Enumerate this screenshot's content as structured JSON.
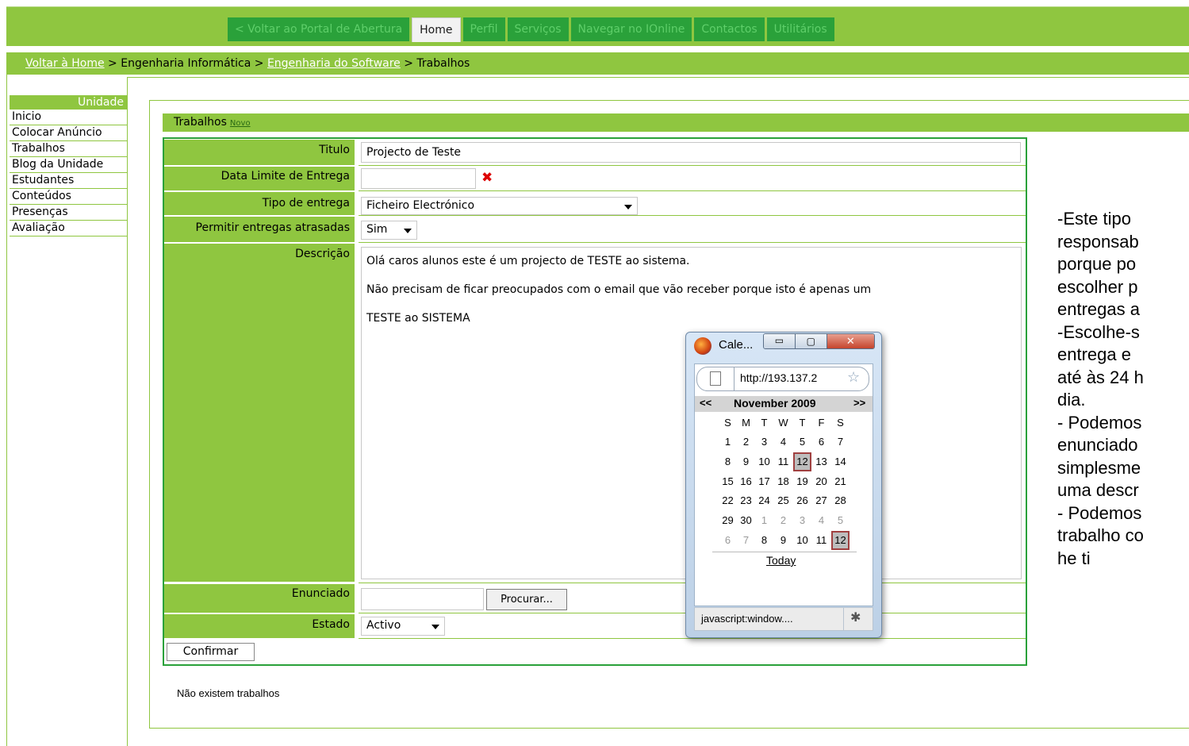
{
  "nav": {
    "tabs": [
      {
        "label": "< Voltar ao Portal de Abertura",
        "active": false
      },
      {
        "label": "Home",
        "active": true
      },
      {
        "label": "Perfil",
        "active": false
      },
      {
        "label": "Serviços",
        "active": false
      },
      {
        "label": "Navegar no IOnline",
        "active": false
      },
      {
        "label": "Contactos",
        "active": false
      },
      {
        "label": "Utilitários",
        "active": false
      }
    ]
  },
  "breadcrumb": {
    "home_link": "Voltar à Home",
    "sep1": " > Engenharia Informática > ",
    "course_link": "Engenharia do Software",
    "sep2": " > Trabalhos"
  },
  "sidebar": {
    "header": "Unidade",
    "items": [
      "Inicio",
      "Colocar Anúncio",
      "Trabalhos",
      "Blog da Unidade",
      "Estudantes",
      "Conteúdos",
      "Presenças",
      "Avaliação"
    ]
  },
  "trabalhos": {
    "title": "Trabalhos",
    "new_link": "Novo",
    "empty_message": "Não existem trabalhos"
  },
  "form": {
    "titulo_label": "Titulo",
    "titulo_value": "Projecto de Teste",
    "data_label": "Data Limite de Entrega",
    "data_value": "",
    "clear_glyph": "✖",
    "tipo_label": "Tipo de entrega",
    "tipo_value": "Ficheiro Electrónico",
    "atrasadas_label": "Permitir entregas atrasadas",
    "atrasadas_value": "Sim",
    "descricao_label": "Descrição",
    "descricao_lines": [
      "Olá caros alunos este é um projecto de TESTE ao sistema.",
      "Não precisam de ficar preocupados com o email que vão receber porque isto é apenas um",
      "TESTE ao SISTEMA"
    ],
    "enunciado_label": "Enunciado",
    "procurar_button": "Procurar...",
    "estado_label": "Estado",
    "estado_value": "Activo",
    "confirmar_button": "Confirmar"
  },
  "popup": {
    "title": "Cale...",
    "url": "http://193.137.2",
    "prev": "<<",
    "next": ">>",
    "month": "November 2009",
    "weekdays": [
      "S",
      "M",
      "T",
      "W",
      "T",
      "F",
      "S"
    ],
    "weeks": [
      [
        "1",
        "2",
        "3",
        "4",
        "5",
        "6",
        "7"
      ],
      [
        "8",
        "9",
        "10",
        "11",
        "12",
        "13",
        "14"
      ],
      [
        "15",
        "16",
        "17",
        "18",
        "19",
        "20",
        "21"
      ],
      [
        "22",
        "23",
        "24",
        "25",
        "26",
        "27",
        "28"
      ],
      [
        "29",
        "30",
        "1",
        "2",
        "3",
        "4",
        "5"
      ],
      [
        "6",
        "7",
        "8",
        "9",
        "10",
        "11",
        "12"
      ]
    ],
    "selected_day": "12",
    "today": "Today",
    "status": "javascript:window...."
  },
  "notes": {
    "lines": [
      "-Este tipo",
      "responsab",
      "porque po",
      "escolher p",
      "entregas a",
      "-Escolhe-s",
      "entrega e",
      "até às 24 h",
      "dia.",
      "- Podemos",
      "enunciado",
      "simplesme",
      "uma descr",
      "- Podemos",
      "trabalho co",
      "he ti"
    ]
  },
  "colors": {
    "green_bar": "#8fc640",
    "dark_green": "#2aa13a",
    "clear_red": "#dd0000"
  }
}
